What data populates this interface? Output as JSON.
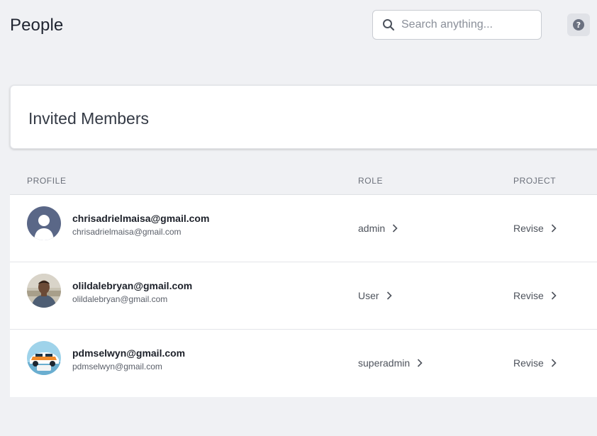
{
  "header": {
    "title": "People",
    "search_placeholder": "Search anything...",
    "search_value": "",
    "help_label": "?"
  },
  "card": {
    "title": "Invited Members"
  },
  "table": {
    "columns": [
      "PROFILE",
      "ROLE",
      "PROJECT"
    ],
    "rows": [
      {
        "name": "chrisadrielmaisa@gmail.com",
        "email": "chrisadrielmaisa@gmail.com",
        "role": "admin",
        "project": "Revise",
        "avatar": "default-silhouette"
      },
      {
        "name": "olildalebryan@gmail.com",
        "email": "olildalebryan@gmail.com",
        "role": "User",
        "project": "Revise",
        "avatar": "photo-person"
      },
      {
        "name": "pdmselwyn@gmail.com",
        "email": "pdmselwyn@gmail.com",
        "role": "superadmin",
        "project": "Revise",
        "avatar": "photo-gulf-car"
      }
    ]
  },
  "colors": {
    "page_bg": "#f0f1f4",
    "card_bg": "#ffffff",
    "silhouette_bg": "#5a6787",
    "help_icon": "#6b7180"
  },
  "icons": {
    "search": "search-icon",
    "help": "help-icon",
    "chevron": "chevron-right-icon"
  }
}
